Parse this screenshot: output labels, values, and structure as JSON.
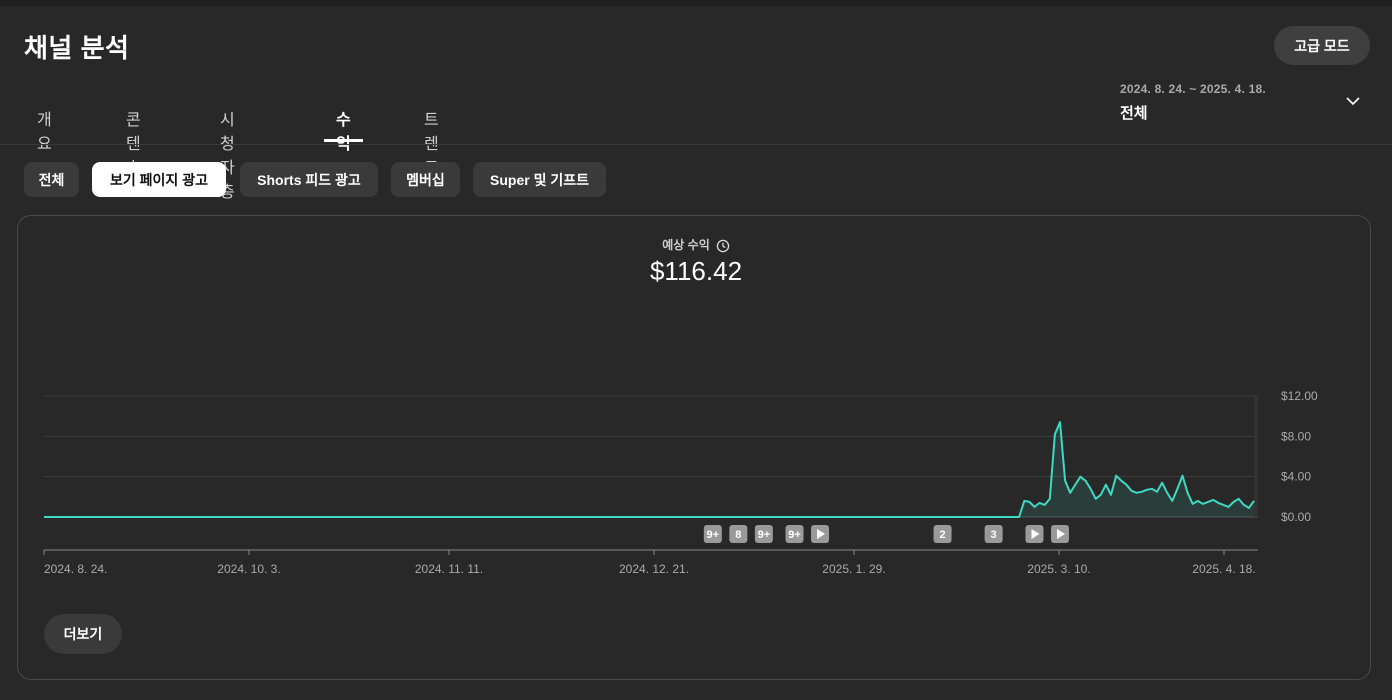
{
  "page": {
    "title": "채널 분석"
  },
  "header": {
    "advanced_mode_label": "고급 모드"
  },
  "tabs": [
    {
      "label": "개요",
      "active": false
    },
    {
      "label": "콘텐츠",
      "active": false
    },
    {
      "label": "시청자층",
      "active": false
    },
    {
      "label": "수익",
      "active": true
    },
    {
      "label": "트렌드",
      "active": false
    }
  ],
  "date_range": {
    "range": "2024. 8. 24. ~ 2025. 4. 18.",
    "period": "전체",
    "icon": "chevron-down-icon"
  },
  "chips": [
    {
      "label": "전체",
      "active": false
    },
    {
      "label": "보기 페이지 광고",
      "active": true
    },
    {
      "label": "Shorts 피드 광고",
      "active": false
    },
    {
      "label": "멤버십",
      "active": false
    },
    {
      "label": "Super 및 기프트",
      "active": false
    }
  ],
  "metric": {
    "label": "예상 수익",
    "value": "$116.42",
    "icon": "clock-icon"
  },
  "chart_data": {
    "type": "area",
    "y_ticks": [
      "$12.00",
      "$8.00",
      "$4.00",
      "$0.00"
    ],
    "ylim": [
      0,
      12
    ],
    "x_tick_labels": [
      "2024. 8. 24.",
      "2024. 10. 3.",
      "2024. 11. 11.",
      "2024. 12. 21.",
      "2025. 1. 29.",
      "2025. 3. 10.",
      "2025. 4. 18."
    ],
    "x": [
      "2025-03-03",
      "2025-03-04",
      "2025-03-05",
      "2025-03-06",
      "2025-03-07",
      "2025-03-08",
      "2025-03-09",
      "2025-03-10",
      "2025-03-11",
      "2025-03-12",
      "2025-03-13",
      "2025-03-14",
      "2025-03-15",
      "2025-03-16",
      "2025-03-17",
      "2025-03-18",
      "2025-03-19",
      "2025-03-20",
      "2025-03-21",
      "2025-03-22",
      "2025-03-23",
      "2025-03-24",
      "2025-03-25",
      "2025-03-26",
      "2025-03-27",
      "2025-03-28",
      "2025-03-29",
      "2025-03-30",
      "2025-03-31",
      "2025-04-01",
      "2025-04-02",
      "2025-04-03",
      "2025-04-04",
      "2025-04-05",
      "2025-04-06",
      "2025-04-07",
      "2025-04-08",
      "2025-04-09",
      "2025-04-10",
      "2025-04-11",
      "2025-04-12",
      "2025-04-13",
      "2025-04-14",
      "2025-04-15",
      "2025-04-16",
      "2025-04-17",
      "2025-04-18"
    ],
    "values": [
      0,
      1.6,
      1.5,
      1.0,
      1.4,
      1.2,
      1.8,
      8.2,
      9.4,
      3.6,
      2.4,
      3.2,
      4.0,
      3.6,
      2.8,
      1.8,
      2.2,
      3.2,
      2.2,
      4.1,
      3.6,
      3.2,
      2.6,
      2.4,
      2.5,
      2.7,
      2.8,
      2.5,
      3.4,
      2.4,
      1.6,
      2.8,
      4.1,
      2.4,
      1.3,
      1.6,
      1.3,
      1.5,
      1.7,
      1.4,
      1.2,
      1.0,
      1.5,
      1.8,
      1.2,
      0.9,
      1.6
    ],
    "line_color": "#3ed8c3",
    "grid": true,
    "markers": [
      {
        "label": "9+",
        "date": "2025-01-02"
      },
      {
        "label": "8",
        "date": "2025-01-07"
      },
      {
        "label": "9+",
        "date": "2025-01-12"
      },
      {
        "label": "9+",
        "date": "2025-01-18"
      },
      {
        "label": "",
        "date": "2025-01-23",
        "icon": "play-icon"
      },
      {
        "label": "2",
        "date": "2025-02-16"
      },
      {
        "label": "3",
        "date": "2025-02-26"
      },
      {
        "label": "",
        "date": "2025-03-06",
        "icon": "play-icon"
      },
      {
        "label": "",
        "date": "2025-03-11",
        "icon": "play-icon"
      }
    ]
  },
  "footer": {
    "more_label": "더보기"
  }
}
